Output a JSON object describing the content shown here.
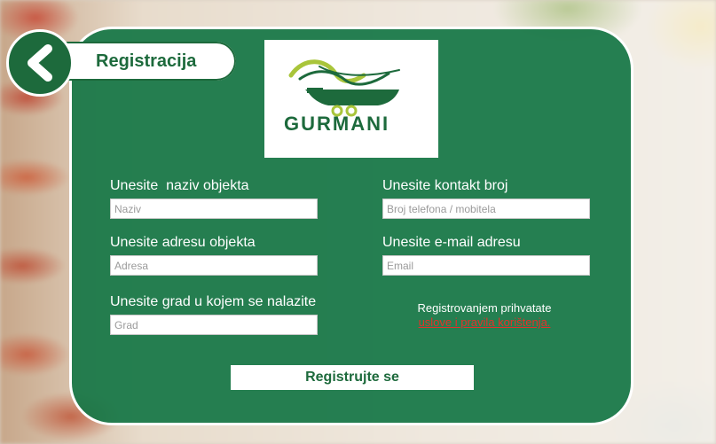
{
  "header": {
    "title": "Registracija",
    "back_icon": "chevron-left-icon"
  },
  "logo": {
    "brand": "GURMANI",
    "colors": {
      "green": "#1d6a3c",
      "lime": "#a9c53a"
    }
  },
  "form": {
    "fields": [
      {
        "label": "Unesite  naziv objekta",
        "placeholder": "Naziv"
      },
      {
        "label": "Unesite adresu objekta",
        "placeholder": "Adresa"
      },
      {
        "label": "Unesite grad u kojem se nalazite",
        "placeholder": "Grad"
      },
      {
        "label": "Unesite kontakt broj",
        "placeholder": "Broj telefona / mobitela"
      },
      {
        "label": "Unesite e-mail adresu",
        "placeholder": "Email"
      }
    ],
    "terms_text": "Registrovanjem prihvatate",
    "terms_link": "uslove i pravila korištenja.",
    "submit_label": "Registrujte se"
  },
  "colors": {
    "panel_green": "#167646",
    "dark_green": "#1d6a3c",
    "link_red": "#e3312b"
  }
}
